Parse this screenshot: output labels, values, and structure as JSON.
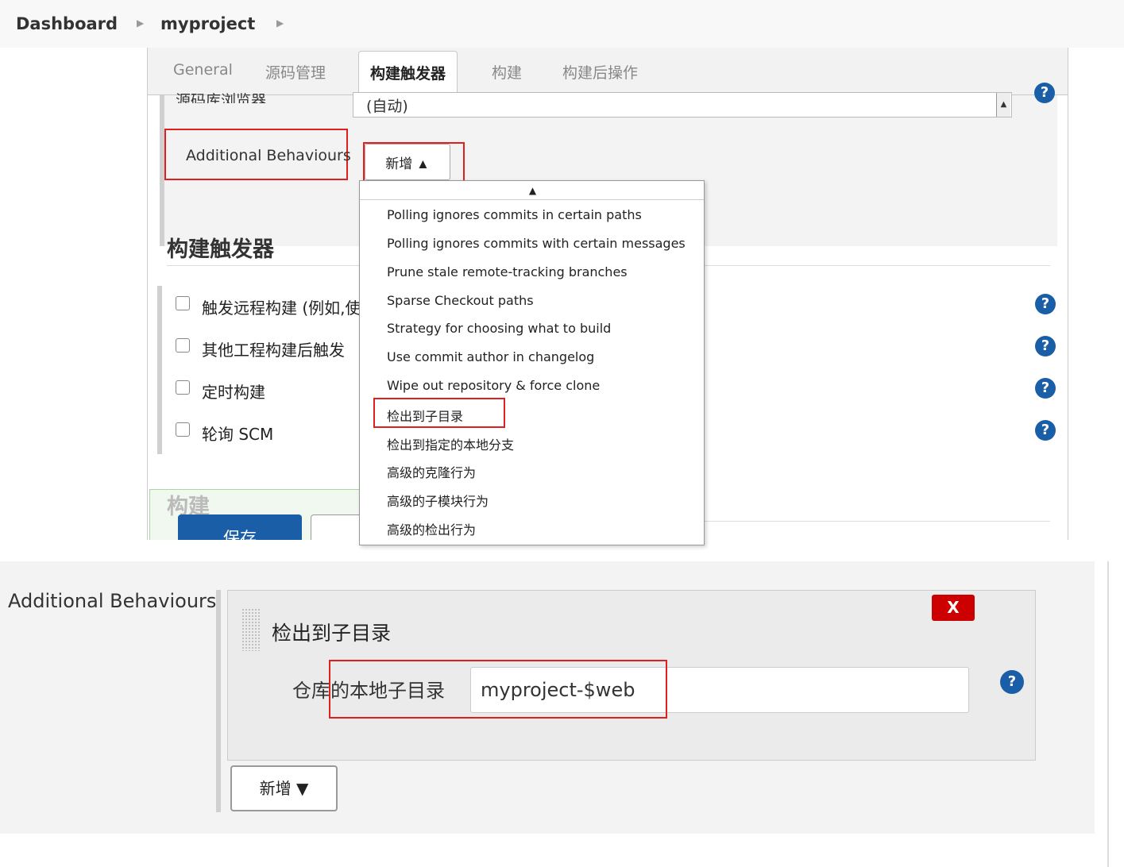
{
  "breadcrumb": {
    "items": [
      "Dashboard",
      "myproject"
    ]
  },
  "tabs": [
    "General",
    "源码管理",
    "构建触发器",
    "构建",
    "构建后操作"
  ],
  "active_tab_index": 2,
  "top_panel": {
    "cut_label": "源码库浏览器",
    "repo_browser_value": "(自动)",
    "additional_behaviours_label": "Additional Behaviours",
    "add_button_label": "新增 ▲",
    "section_heading": "构建触发器",
    "triggers": [
      "触发远程构建 (例如,使",
      "其他工程构建后触发",
      "定时构建",
      "轮询 SCM"
    ],
    "build_section_label": "构建",
    "save_label": "保存"
  },
  "dropdown": {
    "items": [
      "Polling ignores commits in certain paths",
      "Polling ignores commits with certain messages",
      "Prune stale remote-tracking branches",
      "Sparse Checkout paths",
      "Strategy for choosing what to build",
      "Use commit author in changelog",
      "Wipe out repository & force clone",
      "检出到子目录",
      "检出到指定的本地分支",
      "高级的克隆行为",
      "高级的子模块行为",
      "高级的检出行为"
    ],
    "highlighted_index": 7
  },
  "bottom_panel": {
    "additional_behaviours_label": "Additional Behaviours",
    "behaviour_title": "检出到子目录",
    "remove_label": "X",
    "field_label": "仓库的本地子目录",
    "field_value": "myproject-$web",
    "add_button_label": "新增 ▼"
  },
  "icons": {
    "help": "help-icon",
    "breadcrumb_separator": "chevron-right-icon"
  },
  "colors": {
    "accent": "#1a5ea8",
    "highlight_box": "#e02020",
    "remove_button": "#cc0000"
  }
}
